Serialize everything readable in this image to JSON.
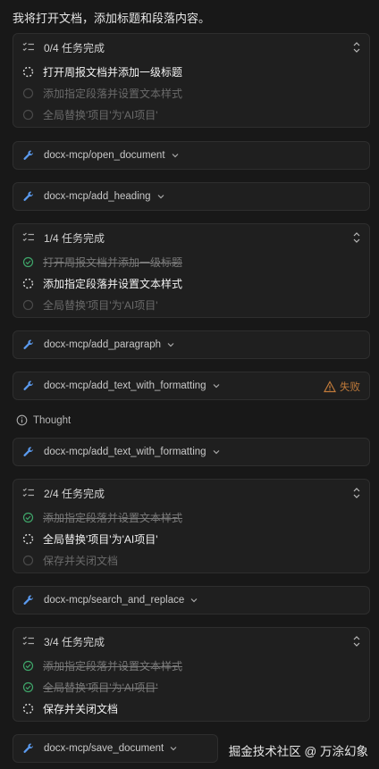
{
  "intro": "我将打开文档，添加标题和段落内容。",
  "thought_label": "Thought",
  "failed_label": "失败",
  "watermark": "掘金技术社区 @ 万涂幻象",
  "colors": {
    "accent": "#3b82f6",
    "done": "#3fa66a",
    "warning": "#c07a3a",
    "background": "#181818"
  },
  "task_groups": [
    {
      "header": "0/4 任务完成",
      "tasks": [
        {
          "label": "打开周报文档并添加一级标题",
          "state": "active"
        },
        {
          "label": "添加指定段落并设置文本样式",
          "state": "pending"
        },
        {
          "label": "全局替换'项目'为'AI项目'",
          "state": "pending"
        }
      ]
    },
    {
      "header": "1/4 任务完成",
      "tasks": [
        {
          "label": "打开周报文档并添加一级标题",
          "state": "done"
        },
        {
          "label": "添加指定段落并设置文本样式",
          "state": "active"
        },
        {
          "label": "全局替换'项目'为'AI项目'",
          "state": "pending"
        }
      ]
    },
    {
      "header": "2/4 任务完成",
      "tasks": [
        {
          "label": "添加指定段落并设置文本样式",
          "state": "done"
        },
        {
          "label": "全局替换'项目'为'AI项目'",
          "state": "active"
        },
        {
          "label": "保存并关闭文档",
          "state": "pending"
        }
      ]
    },
    {
      "header": "3/4 任务完成",
      "tasks": [
        {
          "label": "添加指定段落并设置文本样式",
          "state": "done"
        },
        {
          "label": "全局替换'项目'为'AI项目'",
          "state": "done"
        },
        {
          "label": "保存并关闭文档",
          "state": "active"
        }
      ]
    }
  ],
  "tool_calls": [
    {
      "name": "docx-mcp/open_document"
    },
    {
      "name": "docx-mcp/add_heading"
    },
    {
      "name": "docx-mcp/add_paragraph"
    },
    {
      "name": "docx-mcp/add_text_with_formatting",
      "status": "failed"
    },
    {
      "name": "docx-mcp/add_text_with_formatting"
    },
    {
      "name": "docx-mcp/search_and_replace"
    },
    {
      "name": "docx-mcp/save_document"
    }
  ]
}
